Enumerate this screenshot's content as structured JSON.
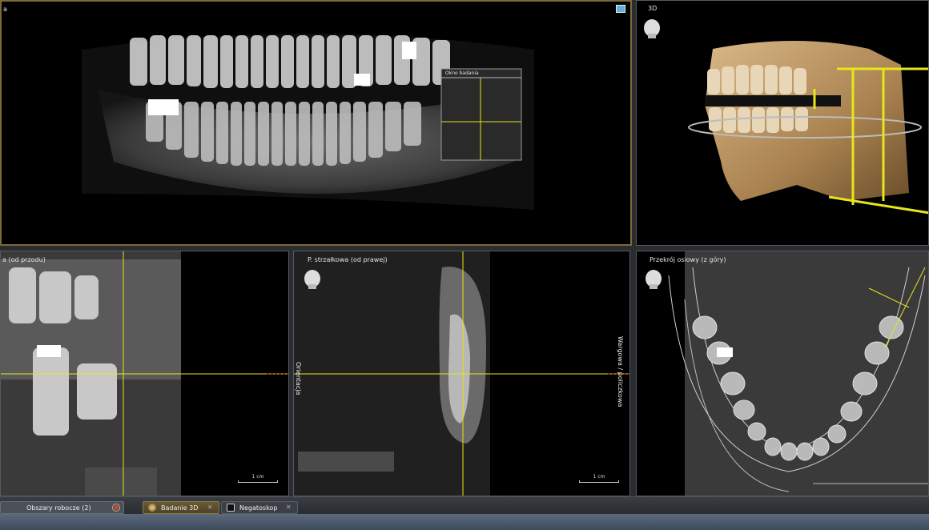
{
  "panes": {
    "panoramic": {
      "title": "a",
      "inset_label": "Okno badania"
    },
    "view3d": {
      "title": "3D"
    },
    "frontal": {
      "title": "a (od przodu)"
    },
    "sagittal": {
      "title": "P. strzałkowa (od prawej)",
      "left_orientation": "Orientacja",
      "right_orientation": "Wargowa / policzkowa",
      "scale_label": "1 cm"
    },
    "axial": {
      "title": "Przekrój osiowy (z góry)"
    },
    "frontal_scale_label": "1 cm"
  },
  "taskbar": {
    "workspace_label": "Obszary robocze (2)",
    "tabs": [
      {
        "label": "Badanie 3D",
        "active": true
      },
      {
        "label": "Negatoskop",
        "active": false
      }
    ]
  },
  "colors": {
    "crosshair": "#e6e61a",
    "active_border": "#7b6a38",
    "bone": "#b89060"
  }
}
